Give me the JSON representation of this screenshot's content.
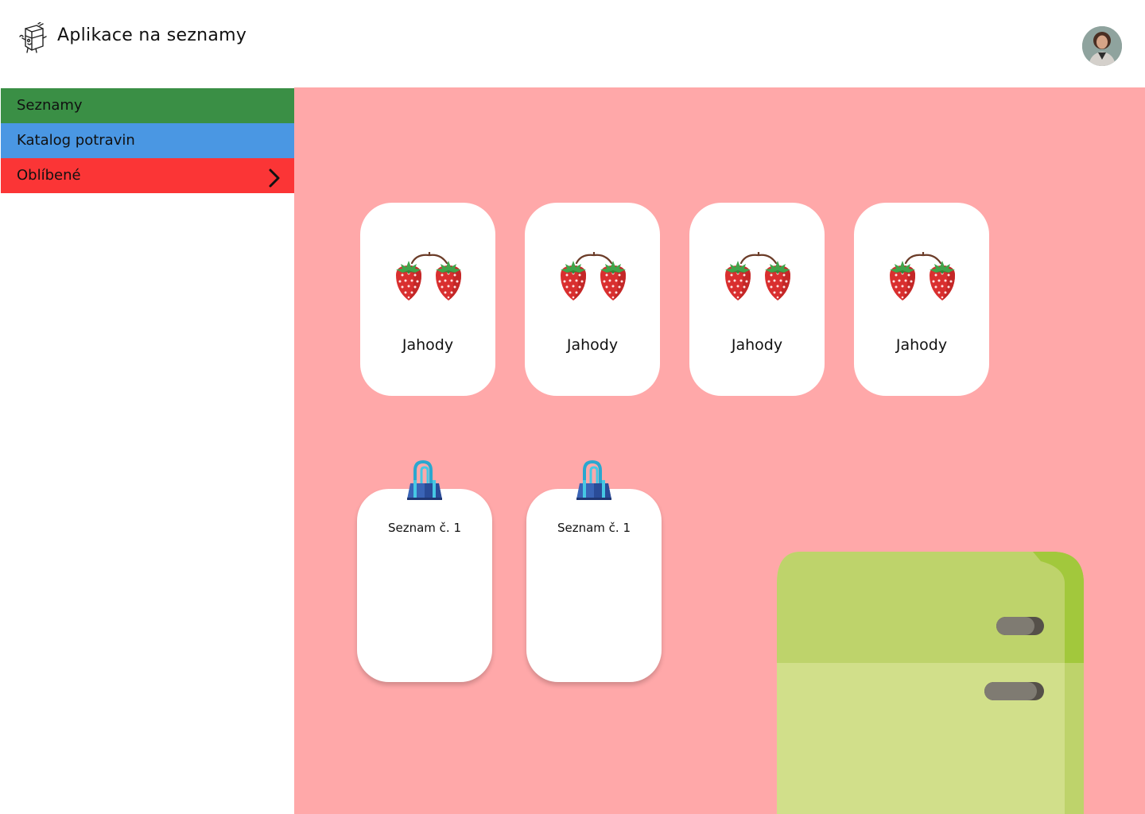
{
  "header": {
    "title": "Aplikace na seznamy",
    "logo_icon": "fridge-sketch-icon",
    "avatar_icon": "user-avatar"
  },
  "sidebar": {
    "items": [
      {
        "label": "Seznamy",
        "color": "#3a8f45"
      },
      {
        "label": "Katalog potravin",
        "color": "#4a97e3"
      },
      {
        "label": "Oblíbené",
        "color": "#fb3536",
        "icon": "chevron-right-icon"
      }
    ]
  },
  "main": {
    "background": "#ffa8a9",
    "favorites": [
      {
        "label": "Jahody",
        "icon": "strawberry-icon"
      },
      {
        "label": "Jahody",
        "icon": "strawberry-icon"
      },
      {
        "label": "Jahody",
        "icon": "strawberry-icon"
      },
      {
        "label": "Jahody",
        "icon": "strawberry-icon"
      }
    ],
    "lists": [
      {
        "title": "Seznam č. 1",
        "icon": "binder-clip-icon"
      },
      {
        "title": "Seznam č. 1",
        "icon": "binder-clip-icon"
      }
    ],
    "decoration_icon": "fridge-icon"
  }
}
